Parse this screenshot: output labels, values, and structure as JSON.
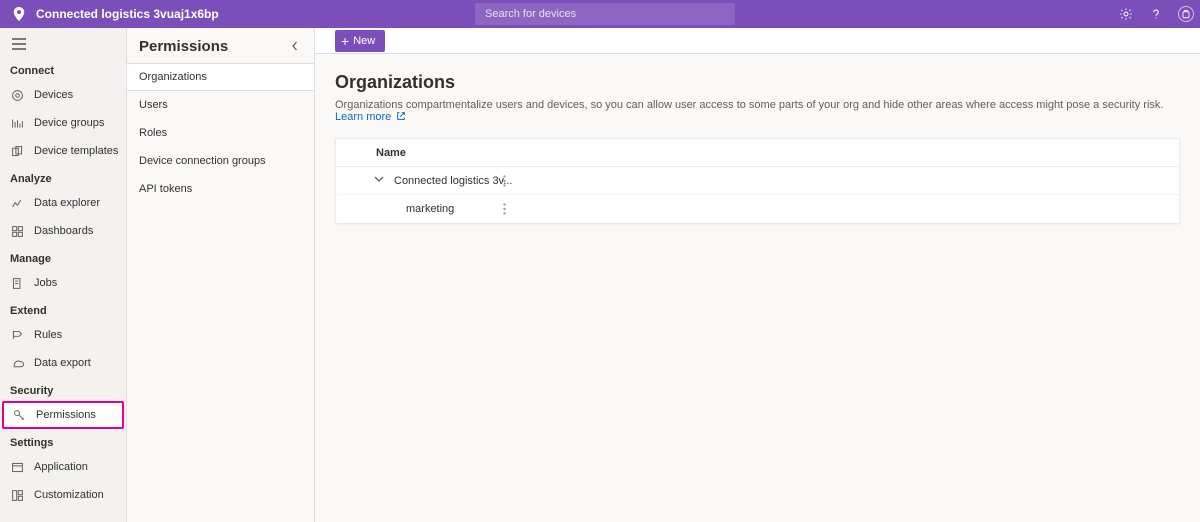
{
  "header": {
    "app_title": "Connected logistics 3vuaj1x6bp",
    "search_placeholder": "Search for devices"
  },
  "leftnav": {
    "sections": [
      {
        "label": "Connect",
        "items": [
          {
            "key": "devices",
            "label": "Devices"
          },
          {
            "key": "device-groups",
            "label": "Device groups"
          },
          {
            "key": "device-templates",
            "label": "Device templates"
          }
        ]
      },
      {
        "label": "Analyze",
        "items": [
          {
            "key": "data-explorer",
            "label": "Data explorer"
          },
          {
            "key": "dashboards",
            "label": "Dashboards"
          }
        ]
      },
      {
        "label": "Manage",
        "items": [
          {
            "key": "jobs",
            "label": "Jobs"
          }
        ]
      },
      {
        "label": "Extend",
        "items": [
          {
            "key": "rules",
            "label": "Rules"
          },
          {
            "key": "data-export",
            "label": "Data export"
          }
        ]
      },
      {
        "label": "Security",
        "items": [
          {
            "key": "permissions",
            "label": "Permissions",
            "active": true,
            "highlighted": true
          }
        ]
      },
      {
        "label": "Settings",
        "items": [
          {
            "key": "application",
            "label": "Application"
          },
          {
            "key": "customization",
            "label": "Customization"
          }
        ]
      }
    ]
  },
  "subnav": {
    "title": "Permissions",
    "items": [
      {
        "key": "organizations",
        "label": "Organizations",
        "active": true
      },
      {
        "key": "users",
        "label": "Users"
      },
      {
        "key": "roles",
        "label": "Roles"
      },
      {
        "key": "device-connection-groups",
        "label": "Device connection groups"
      },
      {
        "key": "api-tokens",
        "label": "API tokens"
      }
    ]
  },
  "commandbar": {
    "new_label": "New"
  },
  "page": {
    "title": "Organizations",
    "description": "Organizations compartmentalize users and devices, so you can allow user access to some parts of your org and hide other areas where access might pose a security risk.",
    "learn_more": "Learn more"
  },
  "table": {
    "columns": {
      "name": "Name"
    },
    "rows": [
      {
        "name": "Connected logistics 3v...",
        "expandable": true
      },
      {
        "name": "marketing",
        "child": true
      }
    ]
  }
}
